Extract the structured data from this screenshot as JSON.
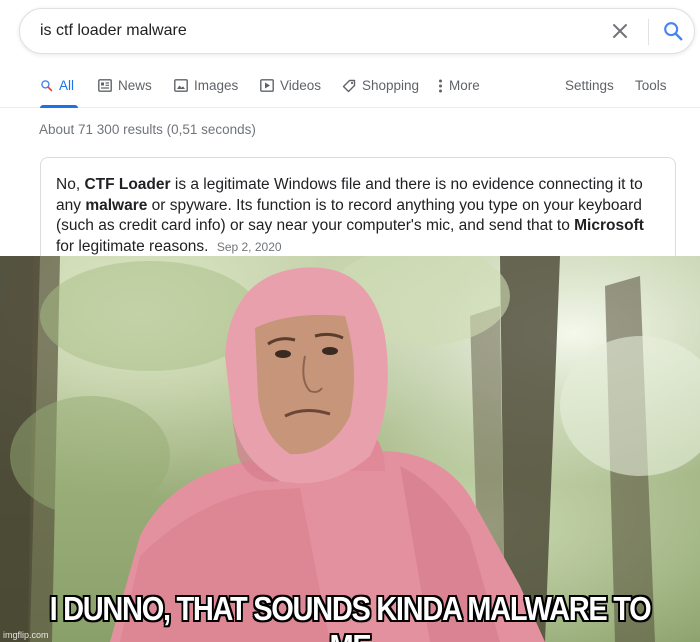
{
  "search": {
    "query": "is ctf loader malware"
  },
  "tabs": {
    "all": "All",
    "news": "News",
    "images": "Images",
    "videos": "Videos",
    "shopping": "Shopping",
    "more": "More",
    "settings": "Settings",
    "tools": "Tools"
  },
  "result_stats": "About 71 300 results (0,51 seconds)",
  "snippet": {
    "part1": "No, ",
    "bold1": "CTF Loader",
    "part2": " is a legitimate Windows file and there is no evidence connecting it to any ",
    "bold2": "malware",
    "part3": " or spyware. Its function is to record anything you type on your keyboard (such as credit card info) or say near your computer's mic, and send that to ",
    "bold3": "Microsoft",
    "part4": " for legitimate reasons.",
    "date": "Sep 2, 2020"
  },
  "meme": {
    "caption": "I DUNNO, THAT SOUNDS KINDA MALWARE TO ME",
    "watermark": "imgflip.com"
  },
  "colors": {
    "accent": "#1a73e8",
    "suit": "#e4919f"
  }
}
